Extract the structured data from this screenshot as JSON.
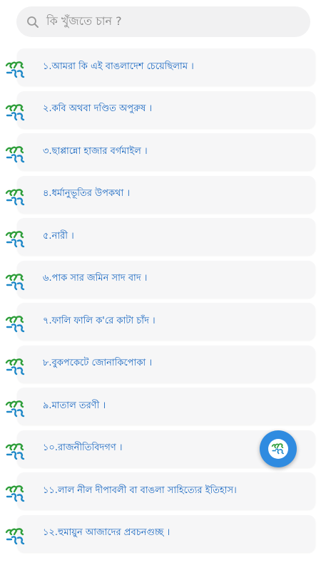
{
  "search": {
    "placeholder": "কি খুঁজতে চান ?",
    "icon": "search-icon"
  },
  "book_list": {
    "logo_icon": "boi-tong-logo-icon",
    "items": [
      {
        "title": "১.আমরা কি এই বাঙলাদেশ চেয়েছিলাম ।"
      },
      {
        "title": "২.কবি অথবা দণ্ডিত অপুরুষ ।"
      },
      {
        "title": "৩.ছাপ্পান্নো হাজার বর্গমাইল ।"
      },
      {
        "title": "৪.ধর্মানুভূতির উপকথা ।"
      },
      {
        "title": "৫.নারী ।"
      },
      {
        "title": "৬.পাক সার জমিন সাদ বাদ ।"
      },
      {
        "title": "৭.ফালি ফালি ক'রে কাটা চাঁদ ।"
      },
      {
        "title": "৮.বুকপকেটে জোনাকিপোকা ।"
      },
      {
        "title": "৯.মাতাল তরণী ।"
      },
      {
        "title": "১০.রাজনীতিবিদগণ ।"
      },
      {
        "title": "১১.লাল নীল দীপাবলী বা বাঙলা সাহিত্যের ইতিহাস।"
      },
      {
        "title": "১২.হুমায়ুন আজাদের প্রবচনগুচ্ছ ।"
      }
    ]
  },
  "fab": {
    "icon": "boi-tong-logo-icon",
    "color": "#2f8be0"
  },
  "colors": {
    "title_text": "#1565c0",
    "card_background": "#f6f6f7",
    "logo_green": "#2e9e3a",
    "logo_blue": "#1e88c8"
  }
}
